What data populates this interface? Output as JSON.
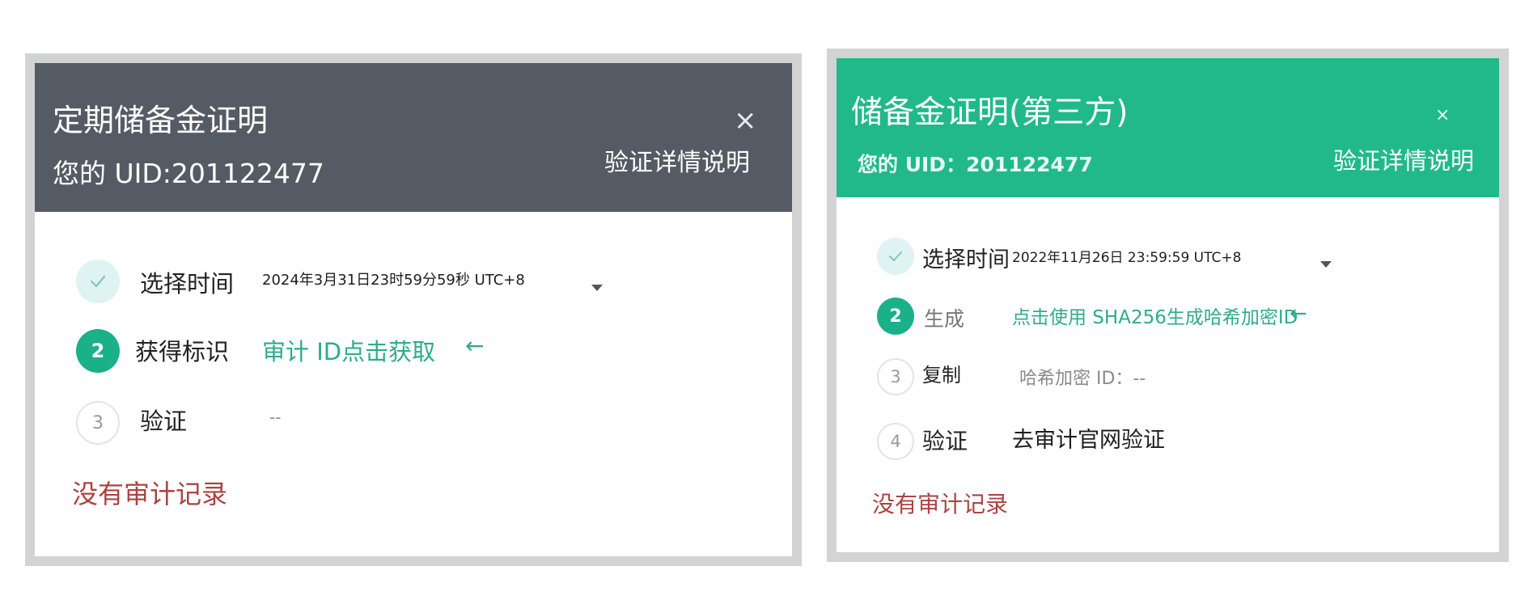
{
  "left_panel": {
    "title": "定期储备金证明",
    "uid_text": "您的 UID:201122477",
    "close_symbol": "×",
    "help_link": "验证详情说明",
    "steps": [
      {
        "number": "",
        "label": "选择时间",
        "value": "2024年3月31日23时59分59秒 UTC+8",
        "status": "done"
      },
      {
        "number": "2",
        "label": "获得标识",
        "value": "审计 ID点击获取",
        "status": "active"
      },
      {
        "number": "3",
        "label": "验证",
        "value": "--",
        "status": "pending"
      }
    ],
    "arrow_symbol": "←",
    "no_record_link": "没有审计记录"
  },
  "right_panel": {
    "title": "储备金证明(第三方)",
    "uid_text": "您的 UID：201122477",
    "close_symbol": "×",
    "help_link": "验证详情说明",
    "steps": [
      {
        "number": "",
        "label": "选择时间",
        "value": "2022年11月26日 23:59:59 UTC+8",
        "status": "done"
      },
      {
        "number": "2",
        "label": "生成",
        "value": "点击使用 SHA256生成哈希加密ID",
        "status": "active"
      },
      {
        "number": "3",
        "label": "复制",
        "value": "哈希加密 ID：--",
        "status": "pending"
      },
      {
        "number": "4",
        "label": "验证",
        "value": "去审计官网验证",
        "status": "pending"
      }
    ],
    "arrow_symbol": "←",
    "no_record_link": "没有审计记录"
  },
  "colors": {
    "left_header": "#555b64",
    "right_header": "#22b98a",
    "accent_green": "#2eab8d",
    "link_red": "#a94442"
  },
  "icons": {
    "close": "close-icon",
    "dropdown": "chevron-down-icon",
    "arrow": "arrow-left-icon",
    "check": "check-icon"
  }
}
